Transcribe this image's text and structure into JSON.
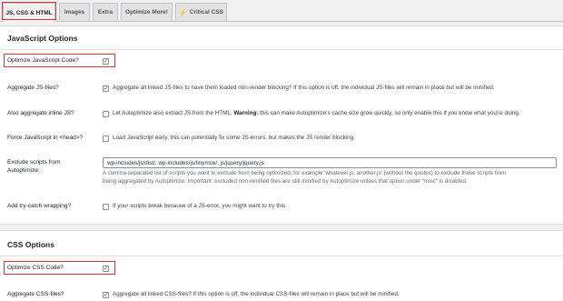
{
  "tabs": [
    {
      "label": "JS, CSS & HTML",
      "active": true
    },
    {
      "label": "Images"
    },
    {
      "label": "Extra"
    },
    {
      "label": "Optimize More!"
    },
    {
      "label": "Critical CSS",
      "icon": "lightning-bolt-icon"
    }
  ],
  "js_section": {
    "title": "JavaScript Options",
    "optimize_js": {
      "label": "Optimize JavaScript Code?",
      "checked": true
    },
    "aggregate_js": {
      "label": "Aggregate JS-files?",
      "checked": true,
      "description": "Aggregate all linked JS-files to have them loaded non-render blocking? If this option is off, the individual JS-files will remain in place but will be minified."
    },
    "inline_js": {
      "label": "Also aggregate inline JS?",
      "checked": false,
      "description_pre": "Let Autoptimize also extract JS from the HTML.",
      "description_bold": "Warning:",
      "description_post": "this can make Autoptimize's cache size grow quickly, so only enable this if you know what you're doing."
    },
    "force_js_head": {
      "label": "Force JavaScript in <head>?",
      "checked": false,
      "description": "Load JavaScript early, this can potentially fix some JS-errors, but makes the JS render blocking."
    },
    "exclude_scripts": {
      "label_line1": "Exclude scripts from",
      "label_line2": "Autoptimize:",
      "value": "wp-includes/js/dist/, wp-includes/js/tinymce/, js/jquery/jquery.js",
      "help_line1": "A comma-separated list of scripts you want to exclude from being optimized, for example 'whatever.js, another.js' (without the quotes) to exclude those scripts from",
      "help_line2": "being aggregated by Autoptimize. Important: excluded non-minified files are still minified by Autoptimize unless that option under \"misc\" is disabled."
    },
    "try_catch": {
      "label": "Add try-catch wrapping?",
      "checked": false,
      "description": "If your scripts break because of a JS-error, you might want to try this."
    }
  },
  "css_section": {
    "title": "CSS Options",
    "optimize_css": {
      "label": "Optimize CSS Code?",
      "checked": true
    },
    "aggregate_css": {
      "label": "Aggregate CSS-files?",
      "checked": true,
      "description": "Aggregate all linked CSS-files? If this option is off, the individual CSS-files will remain in place but will be minified."
    }
  },
  "colors": {
    "highlight": "#d63638",
    "checkmark": "#2271b1",
    "bolt": "#f0b849"
  }
}
